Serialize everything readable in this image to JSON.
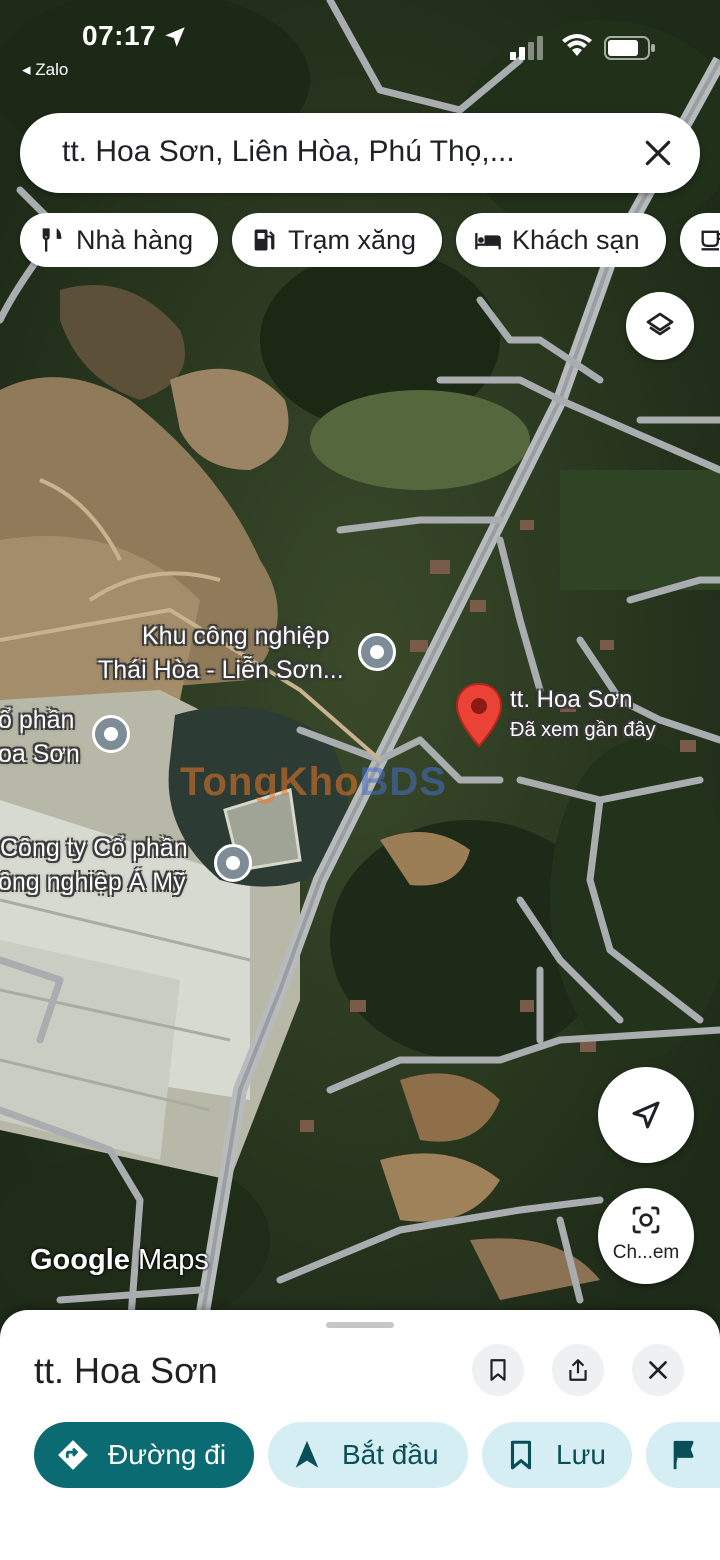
{
  "status_bar": {
    "time": "07:17",
    "back_app": "◂ Zalo",
    "location_icon": "location-arrow-icon",
    "signal_icon": "cellular-signal-icon",
    "wifi_icon": "wifi-icon",
    "battery_icon": "battery-icon"
  },
  "search": {
    "value": "tt. Hoa Sơn, Liên Hòa, Phú Thọ,...",
    "clear_icon": "close-icon"
  },
  "chips": [
    {
      "label": "Nhà hàng",
      "icon": "restaurant-icon"
    },
    {
      "label": "Trạm xăng",
      "icon": "gas-station-icon"
    },
    {
      "label": "Khách sạn",
      "icon": "hotel-bed-icon"
    },
    {
      "label": "",
      "icon": "coffee-icon"
    }
  ],
  "map": {
    "labels": {
      "industrial_park_1": "Khu công nghiệp",
      "industrial_park_2": "Thái Hòa - Liễn Sơn...",
      "company_left_1": "ổ phần",
      "company_left_2": "oa Sơn",
      "company_am_1": "Công ty Cổ phần",
      "company_am_2": "ông nghiệp Á Mỹ",
      "selected_place": "tt. Hoa Sơn",
      "selected_sub": "Đã xem gần đây"
    },
    "watermark": {
      "part_a": "TongKho",
      "part_b": "BDS"
    },
    "attribution": {
      "google": "Google",
      "maps": "Maps"
    },
    "layers_icon": "layers-icon",
    "navigate_icon": "navigation-arrow-icon",
    "lens_icon": "camera-lens-icon",
    "lens_label": "Ch...em",
    "selected_pin_color": "#ea4335"
  },
  "sheet": {
    "title": "tt. Hoa Sơn",
    "icons": [
      "bookmark-icon",
      "share-icon",
      "close-icon"
    ],
    "actions": [
      {
        "label": "Đường đi",
        "icon": "directions-icon",
        "style": "primary"
      },
      {
        "label": "Bắt đầu",
        "icon": "start-navigation-icon",
        "style": "secondary"
      },
      {
        "label": "Lưu",
        "icon": "bookmark-icon",
        "style": "secondary"
      },
      {
        "label": "",
        "icon": "flag-icon",
        "style": "secondary"
      }
    ]
  },
  "colors": {
    "primary_action": "#0b6b73",
    "secondary_action": "#d4eef3",
    "pin_red": "#ea4335"
  }
}
